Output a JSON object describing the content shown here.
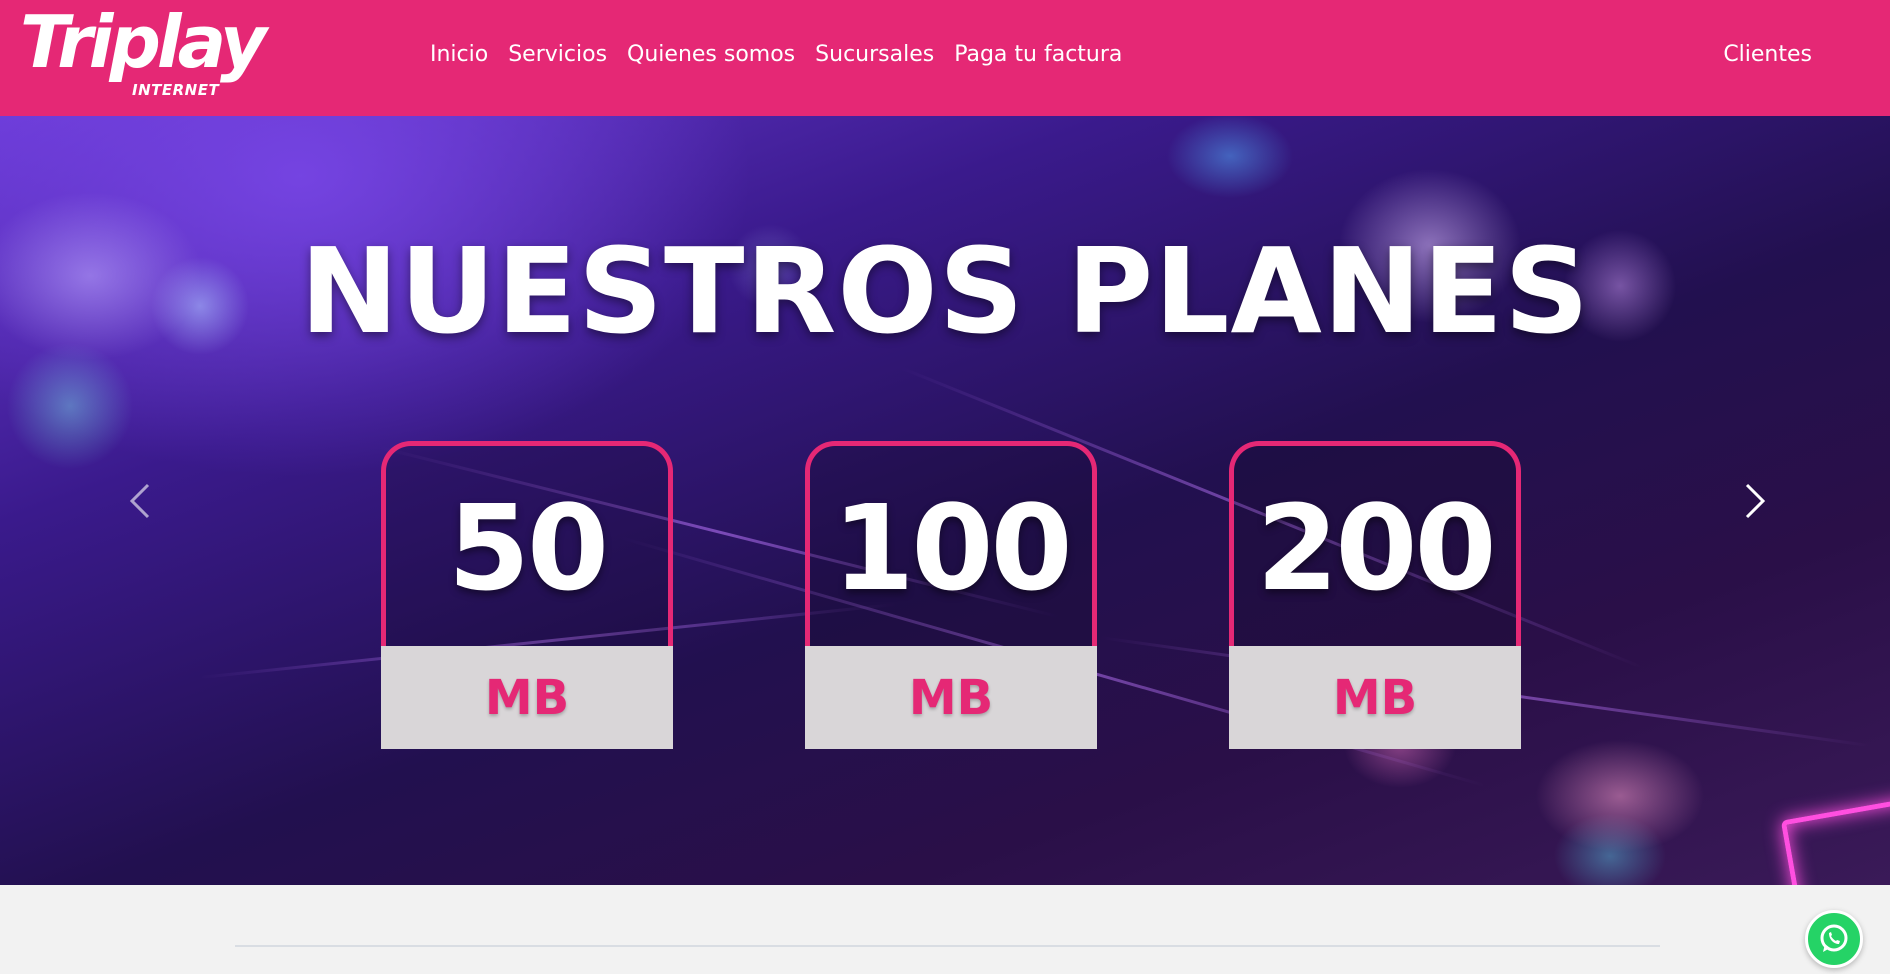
{
  "brand": {
    "name": "Triplay",
    "tagline": "INTERNET",
    "color": "#e52875"
  },
  "nav": {
    "items": [
      {
        "label": "Inicio"
      },
      {
        "label": "Servicios"
      },
      {
        "label": "Quienes somos"
      },
      {
        "label": "Sucursales"
      },
      {
        "label": "Paga tu factura"
      }
    ],
    "clients_label": "Clientes"
  },
  "hero": {
    "title": "NUESTROS PLANES",
    "prev_icon": "chevron-left-icon",
    "next_icon": "chevron-right-icon",
    "plans": [
      {
        "value": "50",
        "unit": "MB"
      },
      {
        "value": "100",
        "unit": "MB"
      },
      {
        "value": "200",
        "unit": "MB"
      }
    ]
  },
  "whatsapp": {
    "icon": "whatsapp-icon",
    "color": "#25d366"
  }
}
